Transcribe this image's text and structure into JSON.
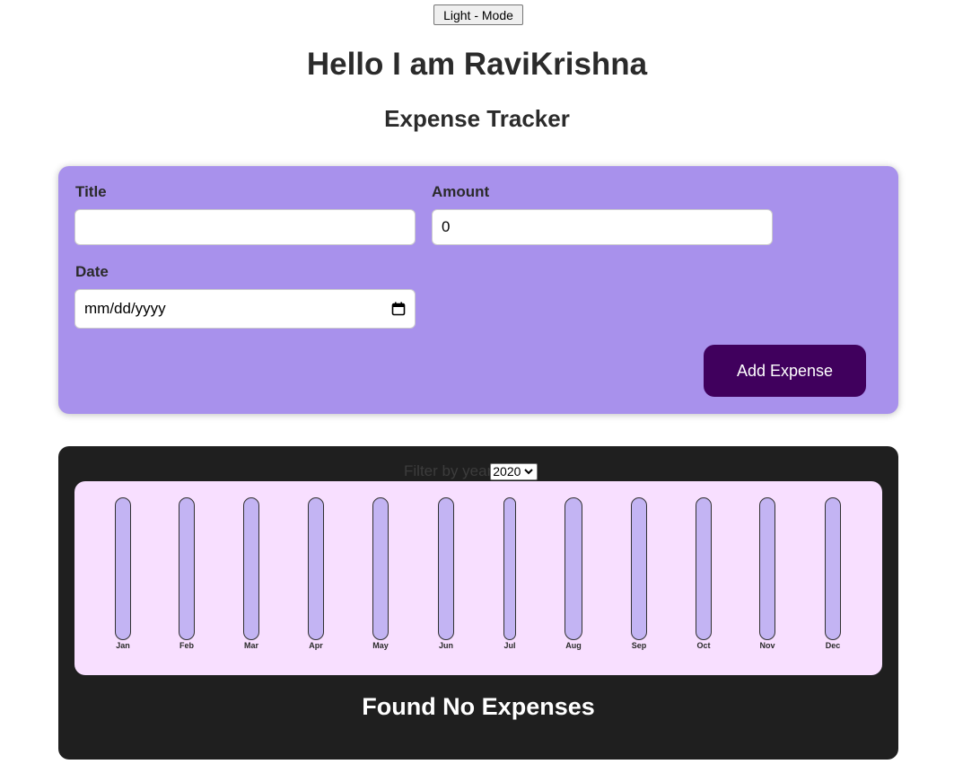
{
  "header": {
    "mode_button_label": "Light - Mode",
    "title": "Hello I am RaviKrishna",
    "subtitle": "Expense Tracker"
  },
  "form": {
    "title_label": "Title",
    "title_value": "",
    "amount_label": "Amount",
    "amount_value": "0",
    "date_label": "Date",
    "date_placeholder": "mm/dd/yyyy",
    "submit_label": "Add Expense",
    "icons": {
      "date_picker": "calendar-icon"
    }
  },
  "expenses": {
    "filter_label": "Filter by year",
    "selected_year": "2020",
    "empty_message": "Found No Expenses"
  },
  "colors": {
    "form_background": "#a891ec",
    "submit_button": "#40005d",
    "expenses_background": "#1f1f1f",
    "chart_background": "#f8dfff",
    "bar_track": "#c3b4f3"
  },
  "chart_data": {
    "type": "bar",
    "categories": [
      "Jan",
      "Feb",
      "Mar",
      "Apr",
      "May",
      "Jun",
      "Jul",
      "Aug",
      "Sep",
      "Oct",
      "Nov",
      "Dec"
    ],
    "values": [
      0,
      0,
      0,
      0,
      0,
      0,
      0,
      0,
      0,
      0,
      0,
      0
    ],
    "title": "",
    "xlabel": "",
    "ylabel": ""
  }
}
